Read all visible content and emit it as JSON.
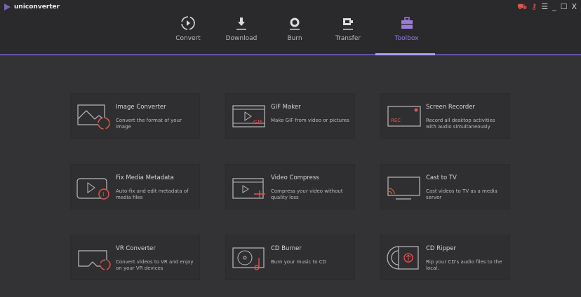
{
  "app": {
    "title": "uniconverter"
  },
  "window": {
    "cart": "cart-icon",
    "key": "key-icon",
    "menu": "☰",
    "minimize": "_",
    "maximize": "☐",
    "close": "X"
  },
  "tabs": [
    {
      "label": "Convert"
    },
    {
      "label": "Download"
    },
    {
      "label": "Burn"
    },
    {
      "label": "Transfer"
    },
    {
      "label": "Toolbox",
      "active": true
    }
  ],
  "accent": "#9b7be0",
  "tools": [
    {
      "title": "Image Converter",
      "desc": "Convert the format of your image"
    },
    {
      "title": "GIF Maker",
      "desc": "Make GIF from video or pictures",
      "badge": "GIF"
    },
    {
      "title": "Screen Recorder",
      "desc": "Record all desktop activities with audio simultaneously",
      "badge": "REC"
    },
    {
      "title": "Fix Media Metadata",
      "desc": "Auto-fix and edit metadata of media files"
    },
    {
      "title": "Video Compress",
      "desc": "Compress your video without quality loss"
    },
    {
      "title": "Cast to TV",
      "desc": "Cast videos to TV as a media server"
    },
    {
      "title": "VR Converter",
      "desc": "Convert videos to VR and enjoy on your VR devices"
    },
    {
      "title": "CD Burner",
      "desc": "Burn your music to CD"
    },
    {
      "title": "CD Ripper",
      "desc": "Rip your CD's audio files to the local."
    }
  ]
}
